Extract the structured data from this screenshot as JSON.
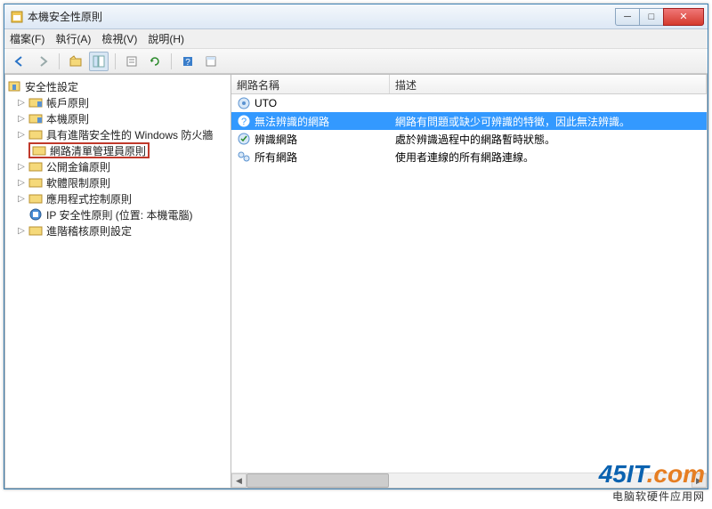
{
  "window": {
    "title": "本機安全性原則"
  },
  "menu": {
    "file": "檔案(F)",
    "action": "執行(A)",
    "view": "檢視(V)",
    "help": "說明(H)"
  },
  "tree": {
    "root": "安全性設定",
    "items": [
      "帳戶原則",
      "本機原則",
      "具有進階安全性的 Windows 防火牆",
      "網路清單管理員原則",
      "公開金鑰原則",
      "軟體限制原則",
      "應用程式控制原則",
      "IP 安全性原則 (位置: 本機電腦)",
      "進階稽核原則設定"
    ]
  },
  "list": {
    "col_name": "網路名稱",
    "col_desc": "描述",
    "rows": [
      {
        "name": "UTO",
        "desc": ""
      },
      {
        "name": "無法辨識的網路",
        "desc": "網路有問題或缺少可辨識的特徵，因此無法辨識。"
      },
      {
        "name": "辨識網路",
        "desc": "處於辨識過程中的網路暫時狀態。"
      },
      {
        "name": "所有網路",
        "desc": "使用者連線的所有網路連線。"
      }
    ]
  },
  "watermark": {
    "brand": "45IT",
    "suffix": ".com",
    "sub": "电脑软硬件应用网"
  }
}
